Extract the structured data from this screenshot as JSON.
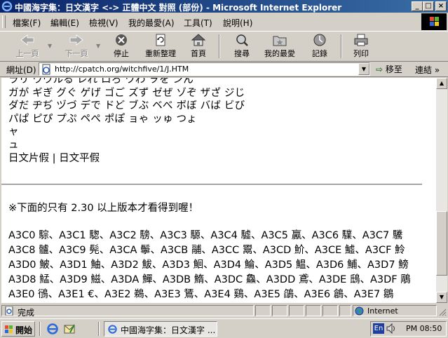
{
  "window": {
    "title": "中國海字集：日文漢字 <-> 正體中文 對照 (部份) - Microsoft Internet Explorer",
    "controls": {
      "minimize": "_",
      "maximize": "□",
      "close": "×"
    }
  },
  "menu": {
    "items": [
      "檔案(F)",
      "編輯(E)",
      "檢視(V)",
      "我的最愛(A)",
      "工具(T)",
      "說明(H)"
    ]
  },
  "toolbar": {
    "back": "上一頁",
    "forward": "下一頁",
    "stop": "停止",
    "refresh": "重新整理",
    "home": "首頁",
    "search": "搜尋",
    "favorites": "我的最愛",
    "history": "記錄",
    "print": "列印"
  },
  "address": {
    "label": "網址(D)",
    "url": "http://cpatch.org/witchfive/1/J.HTM",
    "go_label": "移至",
    "links_label": "連結"
  },
  "page": {
    "kana_lines": [
      "ラリ ウウルる レれ ロろ ワわ ヲを ンん",
      "ガが ギぎ グぐ ゲげ ゴご ズず ゼぜ ゾぞ ザざ ジじ",
      "ダだ ヂぢ ヅづ デで ドど ブぶ ベべ ボぼ バば ビび",
      "パぱ ピぴ プぷ ペぺ ポぽ ョゃ ッゅ つょ",
      "ャ",
      "ュ"
    ],
    "link_katakana": "日文片假",
    "link_separator": " | ",
    "link_hiragana": "日文平假",
    "notice": "※下面的只有 2.30 以上版本才看得到喔！",
    "code_lines": [
      "A3C0 騌、A3C1 騘、A3C2 騯、A3C3 騵、A3C4 驉、A3C5 驘、A3C6 驜、A3C7 驣",
      "A3C8 髗、A3C9 髡、A3CA 鬡、A3CB 鬴、A3CC 鬻、A3CD 魪、A3CE 鱋、A3CF 魿",
      "A3D0 鮍、A3D1 鮋、A3D2 鮁、A3D3 鮰、A3D4 鯩、A3D5 鰛、A3D6 鯆、A3D7 鰟",
      "A3D8 鯭、A3D9 鰦、A3DA 鱓、A3DB 鰖、A3DC 鱻、A3DD 鳶、A3DE 鴟、A3DF 鵰",
      "A3E0 鴴、A3E1 €、A3E2 鵜、A3E3 鵟、A3E4 鷄、A3E5 鵮、A3E6 鶬、A3E7 鶵"
    ]
  },
  "status": {
    "text": "完成",
    "zone": "Internet"
  },
  "taskbar": {
    "start": "開始",
    "task": "中國海字集：日文漢字 ...",
    "lang": "En",
    "clock": "PM 08:50"
  },
  "colors": {
    "titlebar_start": "#0a246a",
    "titlebar_end": "#3a6ea5",
    "face": "#d4d0c8"
  }
}
